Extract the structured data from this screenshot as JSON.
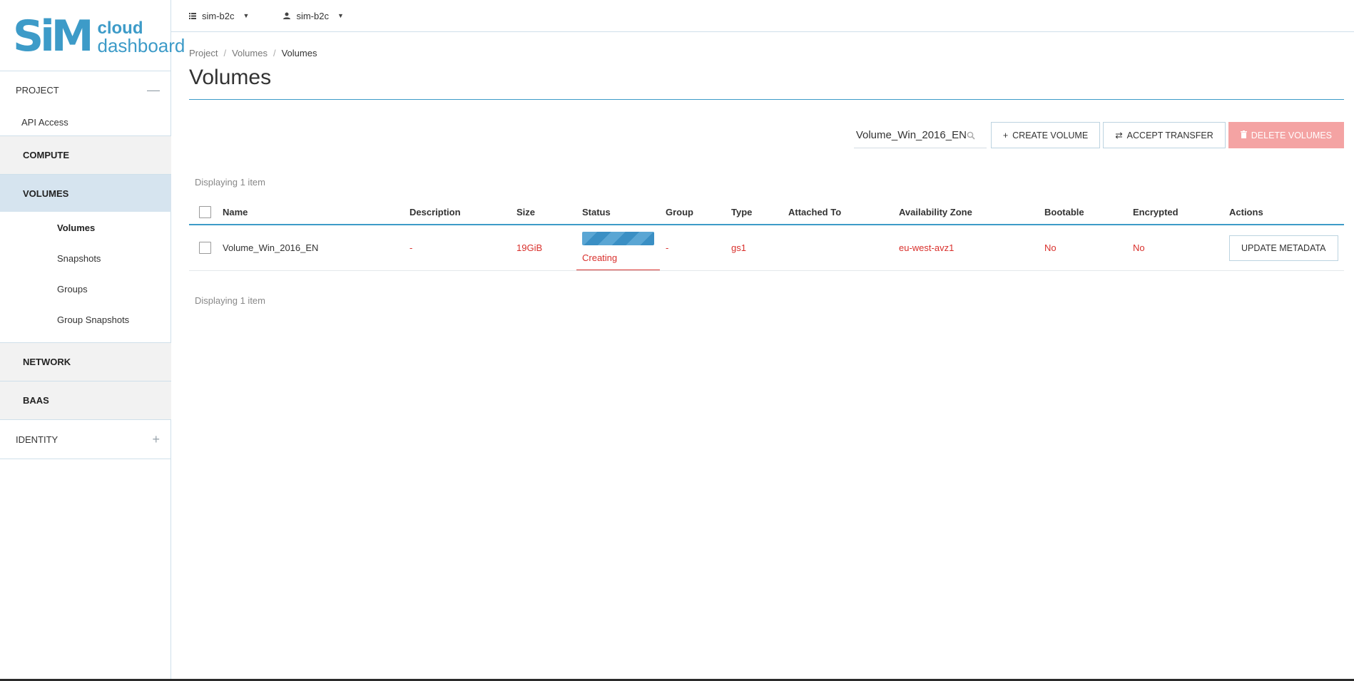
{
  "logo": {
    "mark": "SiM",
    "line1": "cloud",
    "line2": "dashboard"
  },
  "sidebar": {
    "project_label": "PROJECT",
    "project_toggle": "—",
    "api_access": "API Access",
    "compute": "COMPUTE",
    "volumes": "VOLUMES",
    "volumes_items": [
      "Volumes",
      "Snapshots",
      "Groups",
      "Group Snapshots"
    ],
    "network": "NETWORK",
    "baas": "BAAS",
    "identity_label": "IDENTITY",
    "identity_toggle": "+"
  },
  "topbar": {
    "project_selector": "sim-b2c",
    "user_selector": "sim-b2c"
  },
  "breadcrumb": [
    "Project",
    "Volumes",
    "Volumes"
  ],
  "breadcrumb_sep": "/",
  "page_title": "Volumes",
  "toolbar": {
    "filter_value": "Volume_Win_2016_EN",
    "create_volume": "CREATE VOLUME",
    "create_icon": "+",
    "accept_transfer": "ACCEPT TRANSFER",
    "accept_icon": "⇄",
    "delete_volumes": "DELETE VOLUMES"
  },
  "table": {
    "display_count": "Displaying 1 item",
    "columns": [
      "Name",
      "Description",
      "Size",
      "Status",
      "Group",
      "Type",
      "Attached To",
      "Availability Zone",
      "Bootable",
      "Encrypted",
      "Actions"
    ],
    "rows": [
      {
        "name": "Volume_Win_2016_EN",
        "description": "-",
        "size": "19GiB",
        "status": "Creating",
        "group": "-",
        "type": "gs1",
        "attached_to": "",
        "availability_zone": "eu-west-avz1",
        "bootable": "No",
        "encrypted": "No",
        "action": "UPDATE METADATA"
      }
    ]
  },
  "colors": {
    "accent": "#3d9bc8",
    "error": "#d9302c",
    "danger_button": "#f4a3a3",
    "active_nav": "#d6e4ef"
  },
  "icons": {
    "project_selector": "list-icon",
    "user_selector": "user-icon",
    "filter": "search-icon",
    "delete": "trash-icon"
  }
}
